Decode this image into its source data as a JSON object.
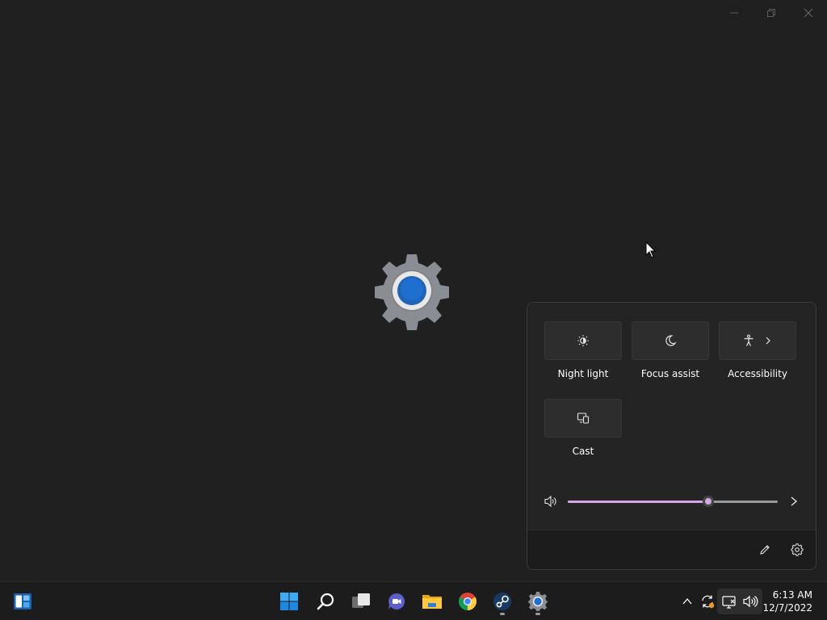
{
  "window": {
    "controls": [
      "minimize",
      "restore",
      "close"
    ]
  },
  "quick_settings": {
    "tiles": [
      {
        "label": "Night light",
        "icon": "night-light-icon"
      },
      {
        "label": "Focus assist",
        "icon": "moon-icon"
      },
      {
        "label": "Accessibility",
        "icon": "accessibility-icon"
      },
      {
        "label": "Cast",
        "icon": "cast-icon"
      }
    ],
    "volume": {
      "level": 0.67,
      "accent_color": "#d8a6e6"
    },
    "footer": {
      "edit_icon": "pencil-icon",
      "settings_icon": "gear-icon"
    }
  },
  "taskbar": {
    "widgets_icon": "widgets-icon",
    "apps": [
      {
        "name": "Start",
        "icon": "windows-start-icon"
      },
      {
        "name": "Search",
        "icon": "search-icon"
      },
      {
        "name": "Task View",
        "icon": "task-view-icon"
      },
      {
        "name": "Chat",
        "icon": "teams-chat-icon"
      },
      {
        "name": "File Explorer",
        "icon": "folder-icon"
      },
      {
        "name": "Chrome",
        "icon": "chrome-icon"
      },
      {
        "name": "Steam",
        "icon": "steam-icon"
      },
      {
        "name": "Settings",
        "icon": "settings-icon"
      }
    ],
    "tray": {
      "icons": [
        "chevron-up-icon",
        "sync-icon",
        "network-icon",
        "volume-icon"
      ]
    },
    "clock": {
      "time": "6:13 AM",
      "date": "12/7/2022"
    }
  }
}
